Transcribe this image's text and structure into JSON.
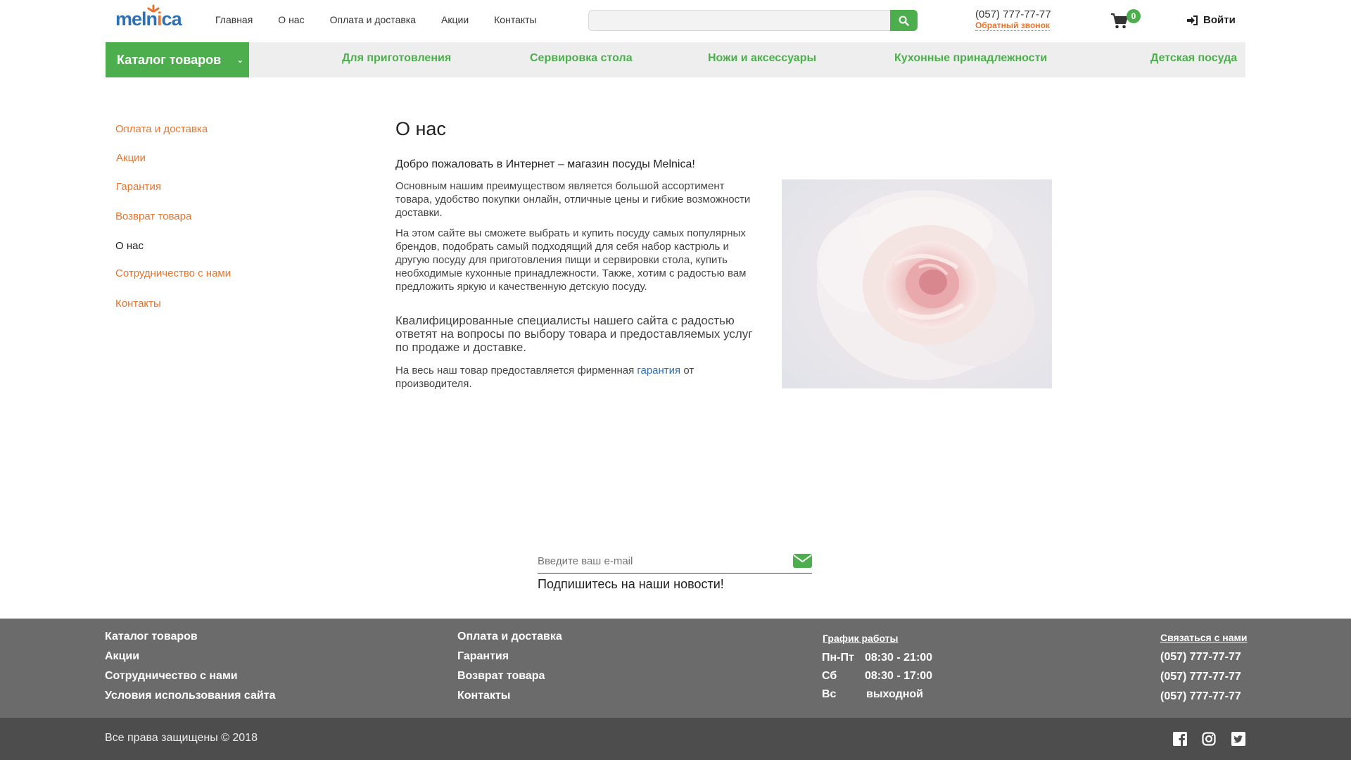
{
  "header": {
    "logo": "melnica",
    "nav": [
      "Главная",
      "О нас",
      "Оплата и доставка",
      "Акции",
      "Контакты"
    ],
    "search_placeholder": "",
    "phone": "(057) 777-77-77",
    "callback": "Обратный звонок",
    "cart_count": "0",
    "login": "Войти"
  },
  "catbar": {
    "catalog": "Каталог товаров",
    "items": [
      "Для приготовления",
      "Сервировка стола",
      "Ножи и аксессуары",
      "Кухонные принадлежности",
      "Детская посуда"
    ]
  },
  "sidebar": [
    "Оплата и доставка",
    "Акции",
    "Гарантия",
    "Возврат товара",
    "О нас",
    "Сотрудничество с нами",
    "Контакты"
  ],
  "content": {
    "title": "О нас",
    "welcome": "Добро пожаловать в Интернет – магазин посуды Melnica!",
    "p1": "Основным нашим преимуществом является большой ассортимент товара, удобство покупки онлайн, отличные цены и гибкие возможности доставки.",
    "p2": "На этом сайте вы сможете выбрать и купить посуду самых популярных брендов, подобрать самый подходящий для себя набор кастрюль и другую посуду для приготовления пищи и сервировки стола, купить необходимые кухонные принадлежности. Также, хотим с радостью вам предложить яркую и качественную детскую посуду.",
    "p3": "Квалифицированные специалисты нашего сайта с радостью ответят на вопросы по выбору товара и предоставляемых услуг по продаже и доставке.",
    "p4_before": "На весь наш товар предоставляется фирменная ",
    "p4_link": "гарантия",
    "p4_after": " от производителя."
  },
  "subscribe": {
    "placeholder": "Введите ваш e-mail",
    "label": "Подпишитесь на наши новости!"
  },
  "footer": {
    "col1": [
      "Каталог товаров",
      "Акции",
      "Сотрудничество с нами",
      "Условия использования сайта"
    ],
    "col2": [
      "Оплата и доставка",
      "Гарантия",
      "Возврат товара",
      "Контакты"
    ],
    "schedule_title": "График работы",
    "schedule": [
      {
        "day": "Пн-Пт",
        "time": "08:30 - 21:00"
      },
      {
        "day": "Сб",
        "time": "08:30 - 17:00"
      },
      {
        "day": "Вс",
        "time": "выходной"
      }
    ],
    "contact_title": "Связаться с нами",
    "phones": [
      "(057) 777-77-77",
      "(057) 777-77-77",
      "(057) 777-77-77"
    ],
    "copyright": "Все права защищены © 2018"
  },
  "colors": {
    "green": "#4cae4c",
    "orange": "#e8742e",
    "blue": "#2f6fb6",
    "footer": "#6b6b6b",
    "footer_bottom": "#4d4d4d"
  },
  "icons": [
    "search-icon",
    "cart-icon",
    "login-icon",
    "chevron-down-icon",
    "envelope-icon",
    "facebook-icon",
    "instagram-icon",
    "twitter-icon"
  ]
}
